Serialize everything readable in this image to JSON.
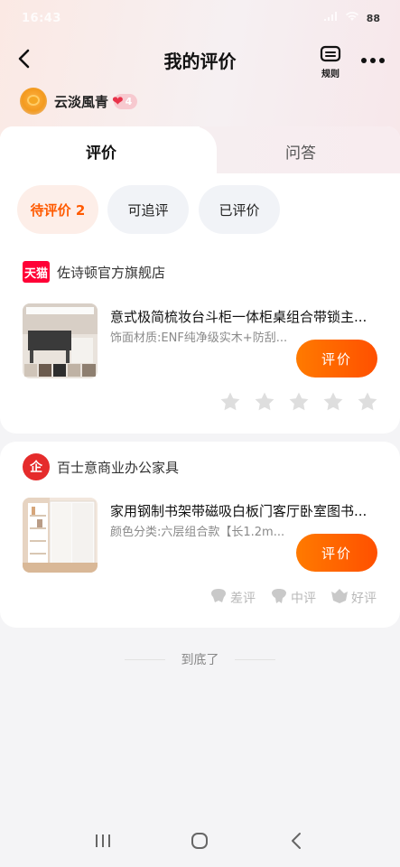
{
  "status": {
    "time": "16:43",
    "battery": "88"
  },
  "nav": {
    "title": "我的评价",
    "rules_label": "规则"
  },
  "user": {
    "name": "云淡風青",
    "level": "4"
  },
  "tabs": [
    {
      "label": "评价"
    },
    {
      "label": "问答"
    }
  ],
  "filters": [
    {
      "label": "待评价 2"
    },
    {
      "label": "可追评"
    },
    {
      "label": "已评价"
    }
  ],
  "orders": [
    {
      "shop_logo": "天猫",
      "shop_name": "佐诗顿官方旗舰店",
      "title": "意式极简梳妆台斗柜一体柜桌组合带锁主...",
      "spec": "饰面材质:ENF纯净级实木+防刮...",
      "button": "评价"
    },
    {
      "shop_logo": "企",
      "shop_name": "百士意商业办公家具",
      "title": "家用钢制书架带磁吸白板门客厅卧室图书...",
      "spec": "颜色分类:六层组合款【长1.2m...",
      "button": "评价",
      "ratings": [
        {
          "label": "差评"
        },
        {
          "label": "中评"
        },
        {
          "label": "好评"
        }
      ]
    }
  ],
  "footer": {
    "end_text": "到底了"
  },
  "colors": {
    "accent": "#ff5a00",
    "tmall": "#ff0036",
    "brand": "#e52b2b"
  }
}
